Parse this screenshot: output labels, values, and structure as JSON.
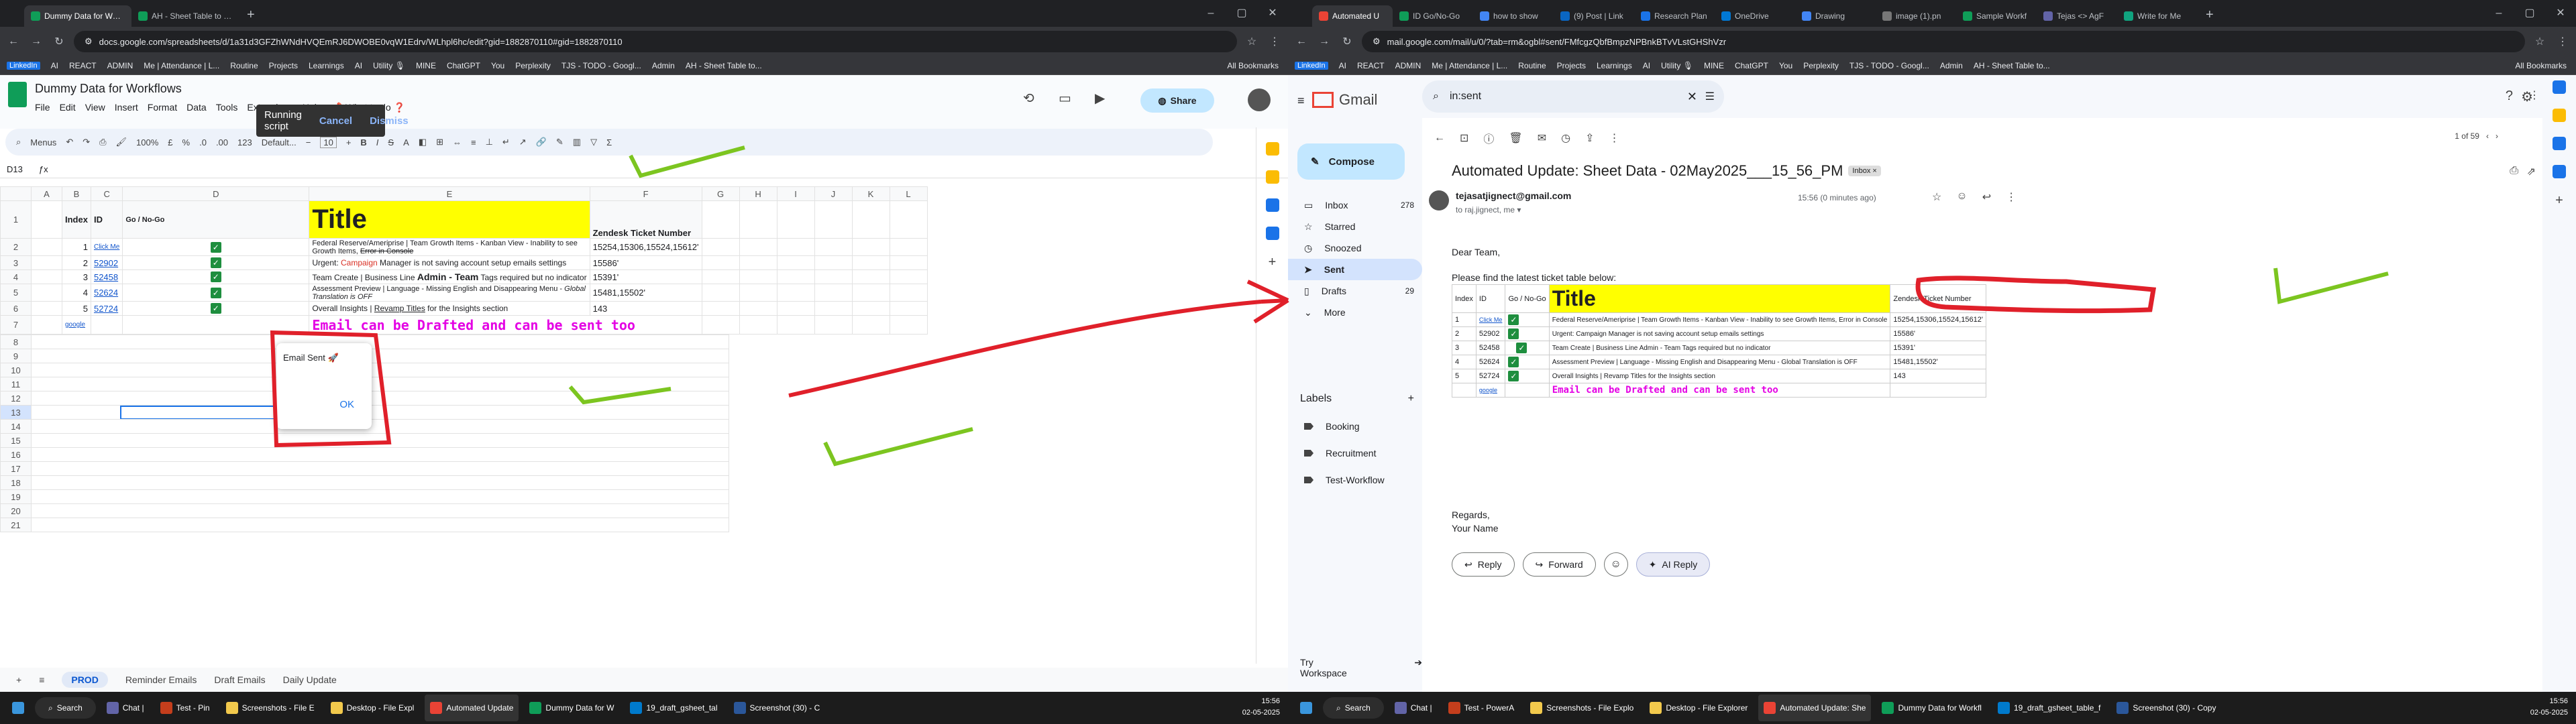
{
  "left": {
    "tabs": [
      {
        "label": "Dummy Data for Workflows - G",
        "color": "#0f9d58",
        "active": true
      },
      {
        "label": "AH - Sheet Table to Email - Au",
        "color": "#0f9d58",
        "active": false
      }
    ],
    "url": "docs.google.com/spreadsheets/d/1a31d3GFZhWNdHVQEmRJ6DWOBE0vqW1Edrv/WLhpl6hc/edit?gid=1882870110#gid=1882870110",
    "bookmarks": [
      "LinkedIn",
      "AI",
      "REACT",
      "ADMIN",
      "Me | Attendance | L...",
      "Routine",
      "Projects",
      "Learnings",
      "AI",
      "Utility 🎙",
      "MINE",
      "ChatGPT",
      "You",
      "Perplexity",
      "TJS - TODO - Googl...",
      "Admin",
      "AH - Sheet Table to...",
      "All Bookmarks"
    ],
    "doc_title": "Dummy Data for Workflows",
    "menu": [
      "File",
      "Edit",
      "View",
      "Insert",
      "Format",
      "Data",
      "Tools",
      "Extensions",
      "Help"
    ],
    "what_to_do": "📌 What to do ❓",
    "share": "Share",
    "toolbar": {
      "menus": "Menus",
      "zoom": "100%",
      "currency": "£",
      "percent": "%",
      "dec1": ".0",
      "dec2": ".00",
      "num": "123",
      "font": "Default...",
      "size": "10"
    },
    "name_box": "D13",
    "col_letters": [
      "A",
      "B",
      "C",
      "D",
      "E",
      "F",
      "G",
      "H",
      "I",
      "J",
      "K",
      "L"
    ],
    "headers": {
      "index": "Index",
      "id": "ID",
      "gonogo": "Go / No-Go",
      "title": "Title",
      "zendesk": "Zendesk Ticket Number"
    },
    "rows": [
      {
        "n": "2",
        "index": "1",
        "id": "Click Me",
        "gonogo": "✓",
        "title": "Federal Reserve/Ameriprise | Team Growth Items - Kanban View - Inability to see Growth Items, ",
        "title_strike": "Error in Console",
        "zendesk": "15254,15306,15524,15612'"
      },
      {
        "n": "3",
        "index": "2",
        "id": "52902",
        "gonogo": "✓",
        "title_pre": "Urgent: ",
        "title_red": "Campaign",
        "title": " Manager is not saving account setup emails settings",
        "zendesk": "15586'"
      },
      {
        "n": "4",
        "index": "3",
        "id": "52458",
        "gonogo": "✓",
        "title_pre": "Team Create | Business Line ",
        "title_bold": "Admin - Team",
        "title": " Tags required but no indicator",
        "zendesk": "15391'"
      },
      {
        "n": "5",
        "index": "4",
        "id": "52624",
        "gonogo": "✓",
        "title": "Assessment Preview | Language - Missing English and Disappearing Menu - ",
        "title_italic": "Global Translation is OFF",
        "zendesk": "15481,15502'"
      },
      {
        "n": "6",
        "index": "5",
        "id": "52724",
        "gonogo": "✓",
        "title_pre": "Overall Insights | ",
        "title_under": "Revamp Titles",
        "title": " for the Insights section",
        "zendesk": "143"
      },
      {
        "n": "7",
        "id": "google",
        "magenta": "Email can be Drafted and can be sent too"
      }
    ],
    "row_numbers": [
      "8",
      "9",
      "10",
      "11",
      "12",
      "13",
      "14",
      "15",
      "16",
      "17",
      "18",
      "19",
      "20",
      "21"
    ],
    "running": {
      "label": "Running script",
      "cancel": "Cancel",
      "dismiss": "Dismiss"
    },
    "dialog": {
      "title": "Email Sent 🚀",
      "ok": "OK"
    },
    "sheets": [
      "PROD",
      "Reminder Emails",
      "Draft Emails",
      "Daily Update"
    ],
    "taskbar": [
      {
        "label": "Search",
        "c": "#2d2d2d"
      },
      {
        "label": "Chat |",
        "c": "#6264a7"
      },
      {
        "label": "Test - Pin",
        "c": "#c43e1c"
      },
      {
        "label": "Screenshots - File E",
        "c": "#f2c94c"
      },
      {
        "label": "Desktop - File Expl",
        "c": "#f2c94c"
      },
      {
        "label": "Automated Update",
        "c": "#ea4335"
      },
      {
        "label": "Dummy Data for W",
        "c": "#0f9d58"
      },
      {
        "label": "19_draft_gsheet_tal",
        "c": "#007acc"
      },
      {
        "label": "Screenshot (30) - C",
        "c": "#2b579a"
      }
    ],
    "lang": "ENG\nIN",
    "clock": {
      "time": "15:56",
      "date": "02-05-2025"
    }
  },
  "right": {
    "tabs": [
      {
        "label": "Automated U",
        "color": "#ea4335",
        "active": true
      },
      {
        "label": "ID Go/No-Go",
        "color": "#0f9d58",
        "active": false
      },
      {
        "label": "how to show",
        "color": "#4285f4",
        "active": false
      },
      {
        "label": "(9) Post | Link",
        "color": "#0a66c2",
        "active": false
      },
      {
        "label": "Research Plan",
        "color": "#1a73e8",
        "active": false
      },
      {
        "label": "OneDrive",
        "color": "#0078d4",
        "active": false
      },
      {
        "label": "Drawing",
        "color": "#4285f4",
        "active": false
      },
      {
        "label": "image (1).pn",
        "color": "#777777",
        "active": false
      },
      {
        "label": "Sample Workf",
        "color": "#0f9d58",
        "active": false
      },
      {
        "label": "Tejas <> AgF",
        "color": "#6264a7",
        "active": false
      },
      {
        "label": "Write for Me",
        "color": "#10a37f",
        "active": false
      }
    ],
    "url": "mail.google.com/mail/u/0/?tab=rm&ogbl#sent/FMfcgzQbfBmpzNPBnkBTvVLstGHShVzr",
    "bookmarks": [
      "LinkedIn",
      "AI",
      "REACT",
      "ADMIN",
      "Me | Attendance | L...",
      "Routine",
      "Projects",
      "Learnings",
      "AI",
      "Utility 🎙",
      "MINE",
      "ChatGPT",
      "You",
      "Perplexity",
      "TJS - TODO - Googl...",
      "Admin",
      "AH - Sheet Table to...",
      "All Bookmarks"
    ],
    "gmail": "Gmail",
    "compose": "Compose",
    "nav": [
      {
        "label": "Inbox",
        "count": "278"
      },
      {
        "label": "Starred",
        "count": ""
      },
      {
        "label": "Snoozed",
        "count": ""
      },
      {
        "label": "Sent",
        "count": "",
        "sel": true
      },
      {
        "label": "Drafts",
        "count": "29"
      },
      {
        "label": "More",
        "count": ""
      }
    ],
    "labels_title": "Labels",
    "labels": [
      "Booking",
      "Recruitment",
      "Test-Workflow"
    ],
    "workspace": "Try Workspace",
    "search": "in:sent",
    "page_count": "1 of 59",
    "subject": "Automated Update: Sheet Data - 02May2025___15_56_PM",
    "inbox_tag": "Inbox ×",
    "sender": "tejasatjignect@gmail.com",
    "to": "to raj.jignect, me ▾",
    "time": "15:56 (0 minutes ago)",
    "greeting": "Dear Team,",
    "intro": "Please find the latest ticket table below:",
    "table_headers": [
      "Index",
      "ID",
      "Go / No-Go",
      "Title",
      "Zendesk Ticket Number"
    ],
    "table_rows": [
      {
        "index": "1",
        "id": "Click Me",
        "title": "Federal Reserve/Ameriprise | Team Growth Items - Kanban View - Inability to see Growth Items, Error in Console",
        "zendesk": "15254,15306,15524,15612'"
      },
      {
        "index": "2",
        "id": "52902",
        "title": "Urgent: Campaign Manager is not saving account setup emails settings",
        "zendesk": "15586'"
      },
      {
        "index": "3",
        "id": "52458",
        "title": "Team Create | Business Line Admin - Team Tags required but no indicator",
        "zendesk": "15391'"
      },
      {
        "index": "4",
        "id": "52624",
        "title": "Assessment Preview | Language - Missing English and Disappearing Menu - Global Translation is OFF",
        "zendesk": "15481,15502'"
      },
      {
        "index": "5",
        "id": "52724",
        "title": "Overall Insights | Revamp Titles for the Insights section",
        "zendesk": "143"
      }
    ],
    "table_link": "google",
    "table_magenta": "Email can be Drafted and can be sent too",
    "regards": "Regards,",
    "signature": "Your Name",
    "reply": "Reply",
    "forward": "Forward",
    "ai_reply": "AI Reply",
    "taskbar": [
      {
        "label": "Search",
        "c": "#2d2d2d"
      },
      {
        "label": "Chat |",
        "c": "#6264a7"
      },
      {
        "label": "Test - PowerA",
        "c": "#c43e1c"
      },
      {
        "label": "Screenshots - File Explo",
        "c": "#f2c94c"
      },
      {
        "label": "Desktop - File Explorer",
        "c": "#f2c94c"
      },
      {
        "label": "Automated Update: She",
        "c": "#ea4335"
      },
      {
        "label": "Dummy Data for Workfl",
        "c": "#0f9d58"
      },
      {
        "label": "19_draft_gsheet_table_f",
        "c": "#007acc"
      },
      {
        "label": "Screenshot (30) - Copy",
        "c": "#2b579a"
      }
    ],
    "clock": {
      "time": "15:56",
      "date": "02-05-2025"
    }
  },
  "colors": {
    "sheets_green": "#0f9d58",
    "gmail_red": "#ea4335",
    "title_yellow": "#ffff00",
    "annotation_red": "#e0202a",
    "annotation_green": "#7cc520",
    "magenta": "#e400e4"
  }
}
